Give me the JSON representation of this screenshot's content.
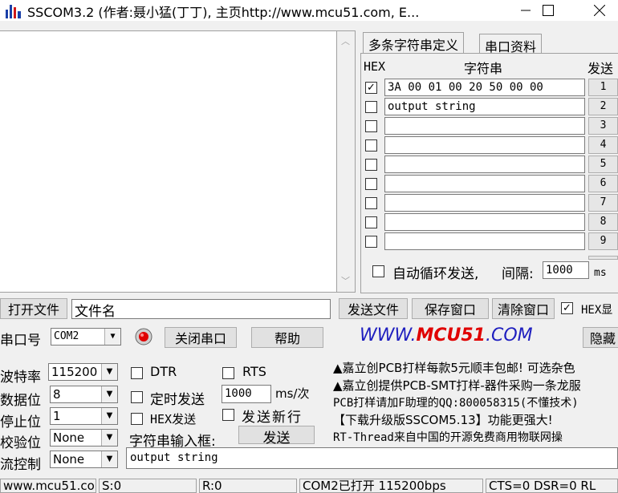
{
  "window": {
    "title": "SSCOM3.2 (作者:聂小猛(丁丁), 主页http://www.mcu51.com,  E..."
  },
  "receive_area": {
    "text": ""
  },
  "tabs": [
    {
      "label": "多条字符串定义",
      "active": true
    },
    {
      "label": "串口资料",
      "active": false
    }
  ],
  "multi_string": {
    "col_hex": "HEX",
    "col_string": "字符串",
    "col_send": "发送",
    "rows": [
      {
        "hex": true,
        "value": "3A 00 01 00 20 50 00 00",
        "send": "1"
      },
      {
        "hex": false,
        "value": "output string",
        "send": "2"
      },
      {
        "hex": false,
        "value": "",
        "send": "3"
      },
      {
        "hex": false,
        "value": "",
        "send": "4"
      },
      {
        "hex": false,
        "value": "",
        "send": "5"
      },
      {
        "hex": false,
        "value": "",
        "send": "6"
      },
      {
        "hex": false,
        "value": "",
        "send": "7"
      },
      {
        "hex": false,
        "value": "",
        "send": "8"
      },
      {
        "hex": false,
        "value": "",
        "send": "9"
      }
    ],
    "auto_loop_label": "自动循环发送,",
    "interval_label": "间隔:",
    "interval_value": "1000",
    "interval_unit": "ms"
  },
  "toolbar1": {
    "open_file": "打开文件",
    "file_name": "文件名",
    "send_file": "发送文件",
    "save_window": "保存窗口",
    "clear_window": "清除窗口",
    "hex_display": "HEX显"
  },
  "toolbar2": {
    "port_label": "串口号",
    "port_value": "COM2",
    "close_port": "关闭串口",
    "help": "帮助",
    "website": {
      "www": "WWW.",
      "mcu": "MCU51",
      "com": ".COM"
    },
    "hide": "隐藏"
  },
  "settings": {
    "baud_label": "波特率",
    "baud_value": "115200",
    "data_label": "数据位",
    "data_value": "8",
    "stop_label": "停止位",
    "stop_value": "1",
    "parity_label": "校验位",
    "parity_value": "None",
    "flow_label": "流控制",
    "flow_value": "None"
  },
  "controls": {
    "dtr": "DTR",
    "rts": "RTS",
    "timed_send": "定时发送",
    "timed_value": "1000",
    "timed_unit": "ms/次",
    "hex_send": "HEX发送",
    "send_newline": "发送新行",
    "input_label": "字符串输入框:",
    "send_button": "发送",
    "input_value": "output string"
  },
  "ads": [
    "▲嘉立创PCB打样每款5元顺丰包邮! 可选杂色",
    "▲嘉立创提供PCB-SMT打样-器件采购一条龙服",
    "PCB打样请加F助理的QQ:800058315(不懂技术)",
    "【下载升级版SSCOM5.13】功能更强大!",
    "RT-Thread来自中国的开源免费商用物联网操"
  ],
  "status": {
    "site": "www.mcu51.cor",
    "sent": "S:0",
    "received": "R:0",
    "port_state": "COM2已打开  115200bps",
    "signals": "CTS=0 DSR=0 RL"
  },
  "colors": {
    "www": "#1f1fbf",
    "mcu": "#e00000"
  }
}
